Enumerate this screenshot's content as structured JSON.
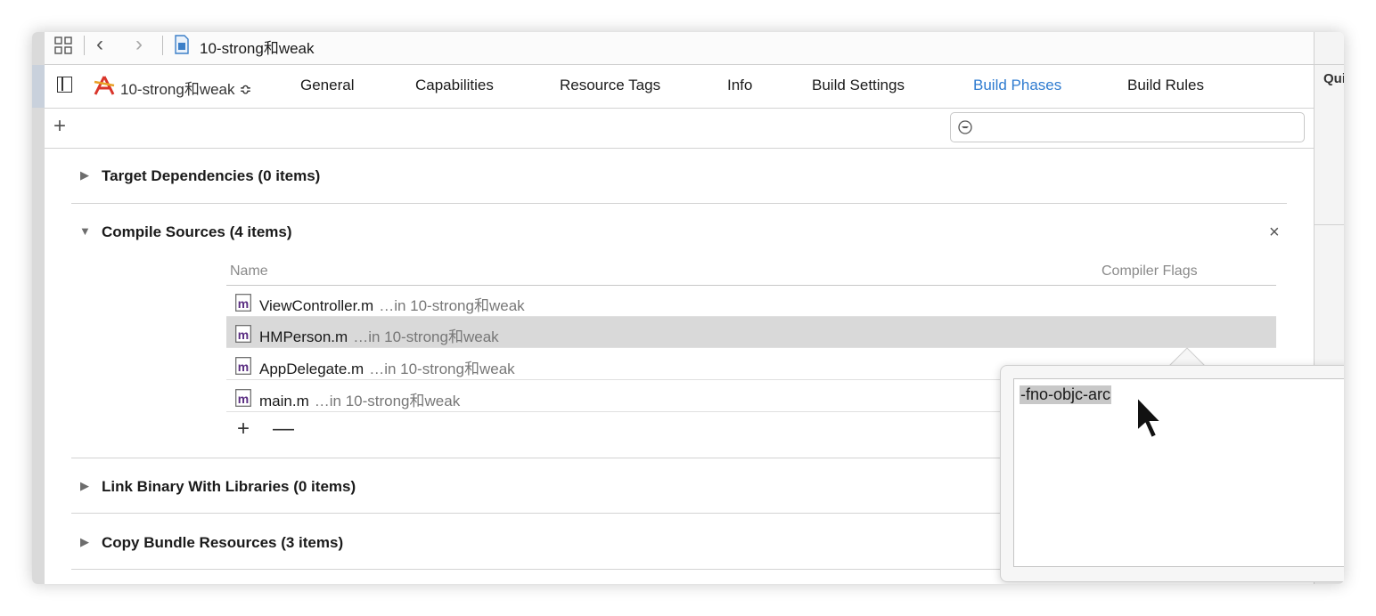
{
  "jumpbar": {
    "title": "10-strong和weak"
  },
  "tabbar": {
    "target": "10-strong和weak ≎",
    "tabs": [
      {
        "label": "General"
      },
      {
        "label": "Capabilities"
      },
      {
        "label": "Resource Tags"
      },
      {
        "label": "Info"
      },
      {
        "label": "Build Settings"
      },
      {
        "label": "Build Phases"
      },
      {
        "label": "Build Rules"
      }
    ],
    "active_tab": "Build Phases",
    "active_color": "#2e7bd0"
  },
  "inspector": {
    "label": "Qui"
  },
  "sections": {
    "target_dependencies": "Target Dependencies (0 items)",
    "compile_sources": "Compile Sources (4 items)",
    "link_binary": "Link Binary With Libraries (0 items)",
    "copy_bundle": "Copy Bundle Resources (3 items)"
  },
  "compile_table": {
    "col_name": "Name",
    "col_flags": "Compiler Flags",
    "rows": [
      {
        "file": "ViewController.m",
        "target": "…in 10-strong和weak"
      },
      {
        "file": "HMPerson.m",
        "target": "…in 10-strong和weak"
      },
      {
        "file": "AppDelegate.m",
        "target": "…in 10-strong和weak"
      },
      {
        "file": "main.m",
        "target": "…in 10-strong和weak"
      }
    ],
    "selected_row": 1,
    "add_label": "+",
    "remove_label": "—"
  },
  "popover": {
    "flags_value": "-fno-objc-arc"
  },
  "icons": {
    "grid": "grid-icon",
    "back": "chevron-left-icon",
    "forward": "chevron-right-icon",
    "file": "file-icon",
    "sidebar": "sidebar-toggle-icon",
    "target": "app-target-icon",
    "add": "plus-icon",
    "filter": "filter-icon",
    "close": "close-icon",
    "source": "m-file-icon",
    "cursor": "mouse-pointer-icon"
  }
}
